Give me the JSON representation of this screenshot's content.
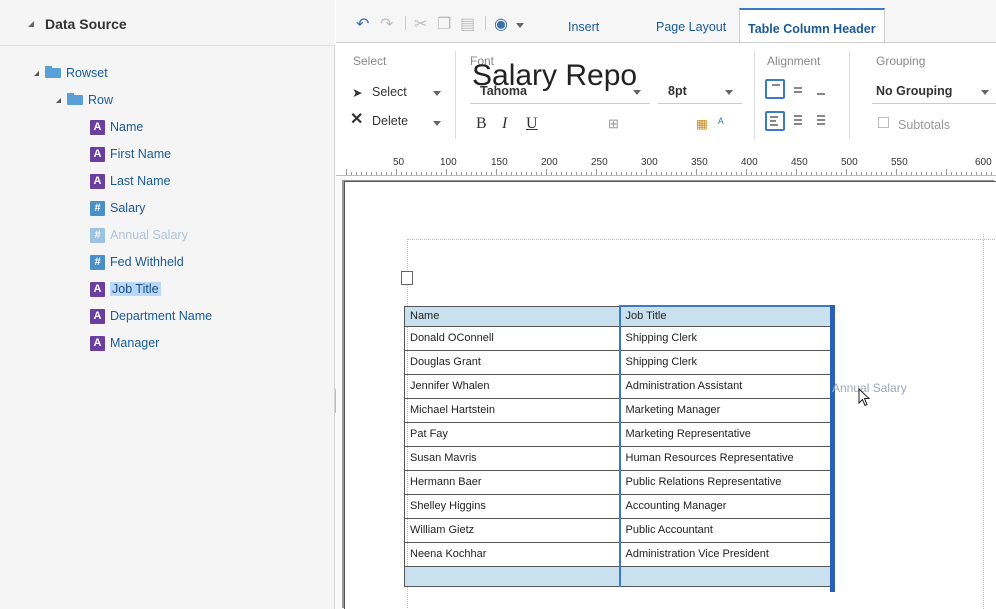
{
  "data_source": {
    "title": "Data Source",
    "rowset": "Rowset",
    "row": "Row",
    "fields": [
      {
        "label": "Name",
        "type": "A"
      },
      {
        "label": "First Name",
        "type": "A"
      },
      {
        "label": "Last Name",
        "type": "A"
      },
      {
        "label": "Salary",
        "type": "#"
      },
      {
        "label": "Annual Salary",
        "type": "#"
      },
      {
        "label": "Fed Withheld",
        "type": "#"
      },
      {
        "label": "Job Title",
        "type": "A"
      },
      {
        "label": "Department Name",
        "type": "A"
      },
      {
        "label": "Manager",
        "type": "A"
      }
    ]
  },
  "toolbar": {
    "tabs": [
      "Insert",
      "Page Layout",
      "Table Column Header"
    ],
    "active_tab": "Table Column Header"
  },
  "ribbon": {
    "select_group": "Select",
    "select_btn": "Select",
    "delete_btn": "Delete",
    "font_group": "Font",
    "font_name": "Tahoma",
    "font_size": "8pt",
    "bold": "B",
    "italic": "I",
    "underline": "U",
    "alignment_group": "Alignment",
    "grouping_group": "Grouping",
    "grouping_value": "No Grouping",
    "subtotals": "Subtotals"
  },
  "ruler": [
    "50",
    "100",
    "150",
    "200",
    "250",
    "300",
    "350",
    "400",
    "450",
    "500",
    "550",
    "600"
  ],
  "report": {
    "title": "Salary Repo",
    "headers": [
      "Name",
      "Job Title"
    ],
    "rows": [
      [
        "Donald OConnell",
        "Shipping Clerk"
      ],
      [
        "Douglas Grant",
        "Shipping Clerk"
      ],
      [
        "Jennifer Whalen",
        "Administration Assistant"
      ],
      [
        "Michael Hartstein",
        "Marketing Manager"
      ],
      [
        "Pat Fay",
        "Marketing Representative"
      ],
      [
        "Susan Mavris",
        "Human Resources Representative"
      ],
      [
        "Hermann Baer",
        "Public Relations Representative"
      ],
      [
        "Shelley Higgins",
        "Accounting Manager"
      ],
      [
        "William Gietz",
        "Public Accountant"
      ],
      [
        "Neena Kochhar",
        "Administration Vice President"
      ]
    ],
    "drag_label": "Annual Salary"
  },
  "colors": {
    "accent": "#3a7ac8",
    "header_fill": "#c9e0ee",
    "text_type_icon": "#6b3fa0",
    "number_type_icon": "#4a90c8"
  }
}
